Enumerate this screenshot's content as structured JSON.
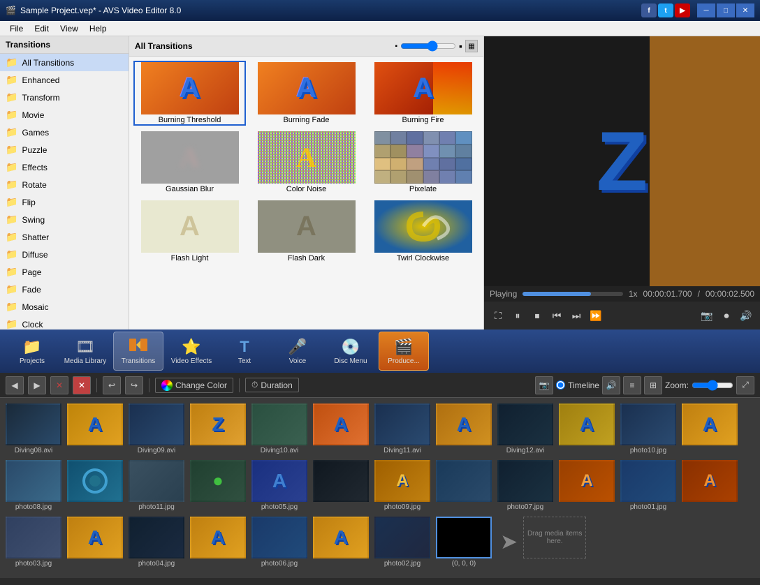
{
  "window": {
    "title": "Sample Project.vep* - AVS Video Editor 8.0",
    "app_icon": "🎬"
  },
  "menubar": {
    "items": [
      "File",
      "Edit",
      "View",
      "Help"
    ]
  },
  "sidebar": {
    "header": "Transitions",
    "items": [
      {
        "id": "all",
        "label": "All Transitions",
        "active": true
      },
      {
        "id": "enhanced",
        "label": "Enhanced"
      },
      {
        "id": "transform",
        "label": "Transform"
      },
      {
        "id": "movie",
        "label": "Movie"
      },
      {
        "id": "games",
        "label": "Games"
      },
      {
        "id": "puzzle",
        "label": "Puzzle"
      },
      {
        "id": "effects",
        "label": "Effects"
      },
      {
        "id": "rotate",
        "label": "Rotate"
      },
      {
        "id": "flip",
        "label": "Flip"
      },
      {
        "id": "swing",
        "label": "Swing"
      },
      {
        "id": "shatter",
        "label": "Shatter"
      },
      {
        "id": "diffuse",
        "label": "Diffuse"
      },
      {
        "id": "page",
        "label": "Page"
      },
      {
        "id": "fade",
        "label": "Fade"
      },
      {
        "id": "mosaic",
        "label": "Mosaic"
      },
      {
        "id": "clock",
        "label": "Clock"
      }
    ]
  },
  "transitions_panel": {
    "header": "All Transitions",
    "items": [
      {
        "id": "burning-threshold",
        "label": "Burning Threshold"
      },
      {
        "id": "burning-fade",
        "label": "Burning Fade"
      },
      {
        "id": "burning-fire",
        "label": "Burning Fire"
      },
      {
        "id": "gaussian-blur",
        "label": "Gaussian Blur"
      },
      {
        "id": "color-noise",
        "label": "Color Noise"
      },
      {
        "id": "pixelate",
        "label": "Pixelate"
      },
      {
        "id": "flash-light",
        "label": "Flash Light"
      },
      {
        "id": "flash-dark",
        "label": "Flash Dark"
      },
      {
        "id": "twirl-clockwise",
        "label": "Twirl Clockwise"
      }
    ]
  },
  "video_status": {
    "playing": "Playing",
    "speed": "1x",
    "current_time": "00:00:01.700",
    "total_time": "00:00:02.500"
  },
  "toolbar": {
    "buttons": [
      {
        "id": "projects",
        "label": "Projects",
        "icon": "📁"
      },
      {
        "id": "media-library",
        "label": "Media Library",
        "icon": "🎞"
      },
      {
        "id": "transitions",
        "label": "Transitions",
        "icon": "🔀",
        "active": true
      },
      {
        "id": "video-effects",
        "label": "Video Effects",
        "icon": "⭐"
      },
      {
        "id": "text",
        "label": "Text",
        "icon": "T"
      },
      {
        "id": "voice",
        "label": "Voice",
        "icon": "🔥"
      },
      {
        "id": "disc-menu",
        "label": "Disc Menu",
        "icon": "💿"
      },
      {
        "id": "produce",
        "label": "Produce...",
        "icon": "🎬"
      }
    ]
  },
  "timeline": {
    "change_color_label": "Change Color",
    "duration_label": "Duration",
    "timeline_label": "Timeline",
    "zoom_label": "Zoom:",
    "view_options": [
      "Timeline"
    ]
  },
  "media_items": [
    {
      "id": "diving08",
      "label": "Diving08.avi",
      "type": "video"
    },
    {
      "id": "a1",
      "label": "",
      "type": "transition"
    },
    {
      "id": "diving09",
      "label": "Diving09.avi",
      "type": "video"
    },
    {
      "id": "z1",
      "label": "",
      "type": "transition"
    },
    {
      "id": "diving10",
      "label": "Diving10.avi",
      "type": "video"
    },
    {
      "id": "a2",
      "label": "",
      "type": "transition"
    },
    {
      "id": "diving11",
      "label": "Diving11.avi",
      "type": "video"
    },
    {
      "id": "a3",
      "label": "",
      "type": "transition"
    },
    {
      "id": "diving12",
      "label": "Diving12.avi",
      "type": "video"
    },
    {
      "id": "a4",
      "label": "",
      "type": "transition"
    },
    {
      "id": "photo10",
      "label": "photo10.jpg",
      "type": "image"
    },
    {
      "id": "a5",
      "label": "",
      "type": "transition"
    },
    {
      "id": "photo08",
      "label": "photo08.jpg",
      "type": "image"
    },
    {
      "id": "a6",
      "label": "",
      "type": "transition"
    },
    {
      "id": "photo11",
      "label": "photo11.jpg",
      "type": "image"
    },
    {
      "id": "a7",
      "label": "",
      "type": "transition"
    },
    {
      "id": "photo05",
      "label": "photo05.jpg",
      "type": "image"
    },
    {
      "id": "a8",
      "label": "",
      "type": "transition"
    },
    {
      "id": "photo09",
      "label": "photo09.jpg",
      "type": "image"
    },
    {
      "id": "a9",
      "label": "",
      "type": "transition"
    },
    {
      "id": "photo07",
      "label": "photo07.jpg",
      "type": "image"
    },
    {
      "id": "a10",
      "label": "",
      "type": "transition"
    },
    {
      "id": "photo01",
      "label": "photo01.jpg",
      "type": "image"
    },
    {
      "id": "a11",
      "label": "",
      "type": "transition"
    },
    {
      "id": "photo03",
      "label": "photo03.jpg",
      "type": "image"
    },
    {
      "id": "a12",
      "label": "",
      "type": "transition"
    },
    {
      "id": "photo04",
      "label": "photo04.jpg",
      "type": "image"
    },
    {
      "id": "a13",
      "label": "",
      "type": "transition"
    },
    {
      "id": "photo06",
      "label": "photo06.jpg",
      "type": "image"
    },
    {
      "id": "a14",
      "label": "",
      "type": "transition"
    },
    {
      "id": "photo02",
      "label": "photo02.jpg",
      "type": "image"
    },
    {
      "id": "selected",
      "label": "(0, 0, 0)",
      "type": "selected"
    },
    {
      "id": "drag-area",
      "label": "Drag media items here.",
      "type": "drag"
    }
  ]
}
